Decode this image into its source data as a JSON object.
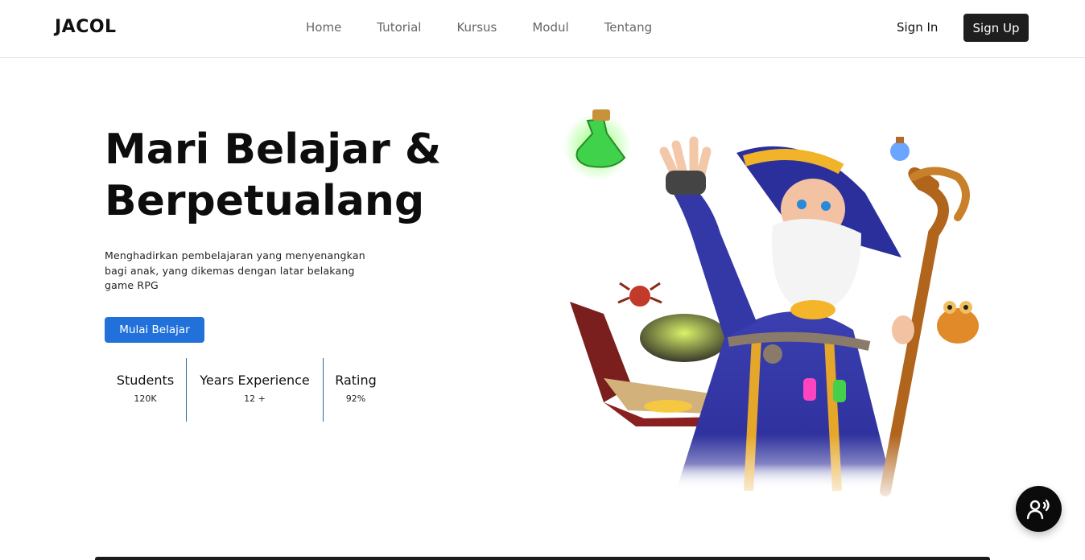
{
  "nav": {
    "logo": "JACOL",
    "items": [
      "Home",
      "Tutorial",
      "Kursus",
      "Modul",
      "Tentang"
    ],
    "sign_in": "Sign In",
    "sign_up": "Sign Up"
  },
  "hero": {
    "title_line1": "Mari Belajar &",
    "title_line2": "Berpetualang",
    "description": "Menghadirkan pembelajaran yang menyenangkan bagi anak, yang dikemas dengan latar belakang game RPG",
    "cta": "Mulai Belajar"
  },
  "stats": [
    {
      "label": "Students",
      "value": "120K"
    },
    {
      "label": "Years Experience",
      "value": "12 +"
    },
    {
      "label": "Rating",
      "value": "92%"
    }
  ],
  "colors": {
    "primary_button": "#2271db",
    "dark_button": "#1e1e1e",
    "divider": "#2a6a9a"
  },
  "icons": {
    "fab": "voice-assistant-icon",
    "illustration": "wizard-illustration"
  }
}
